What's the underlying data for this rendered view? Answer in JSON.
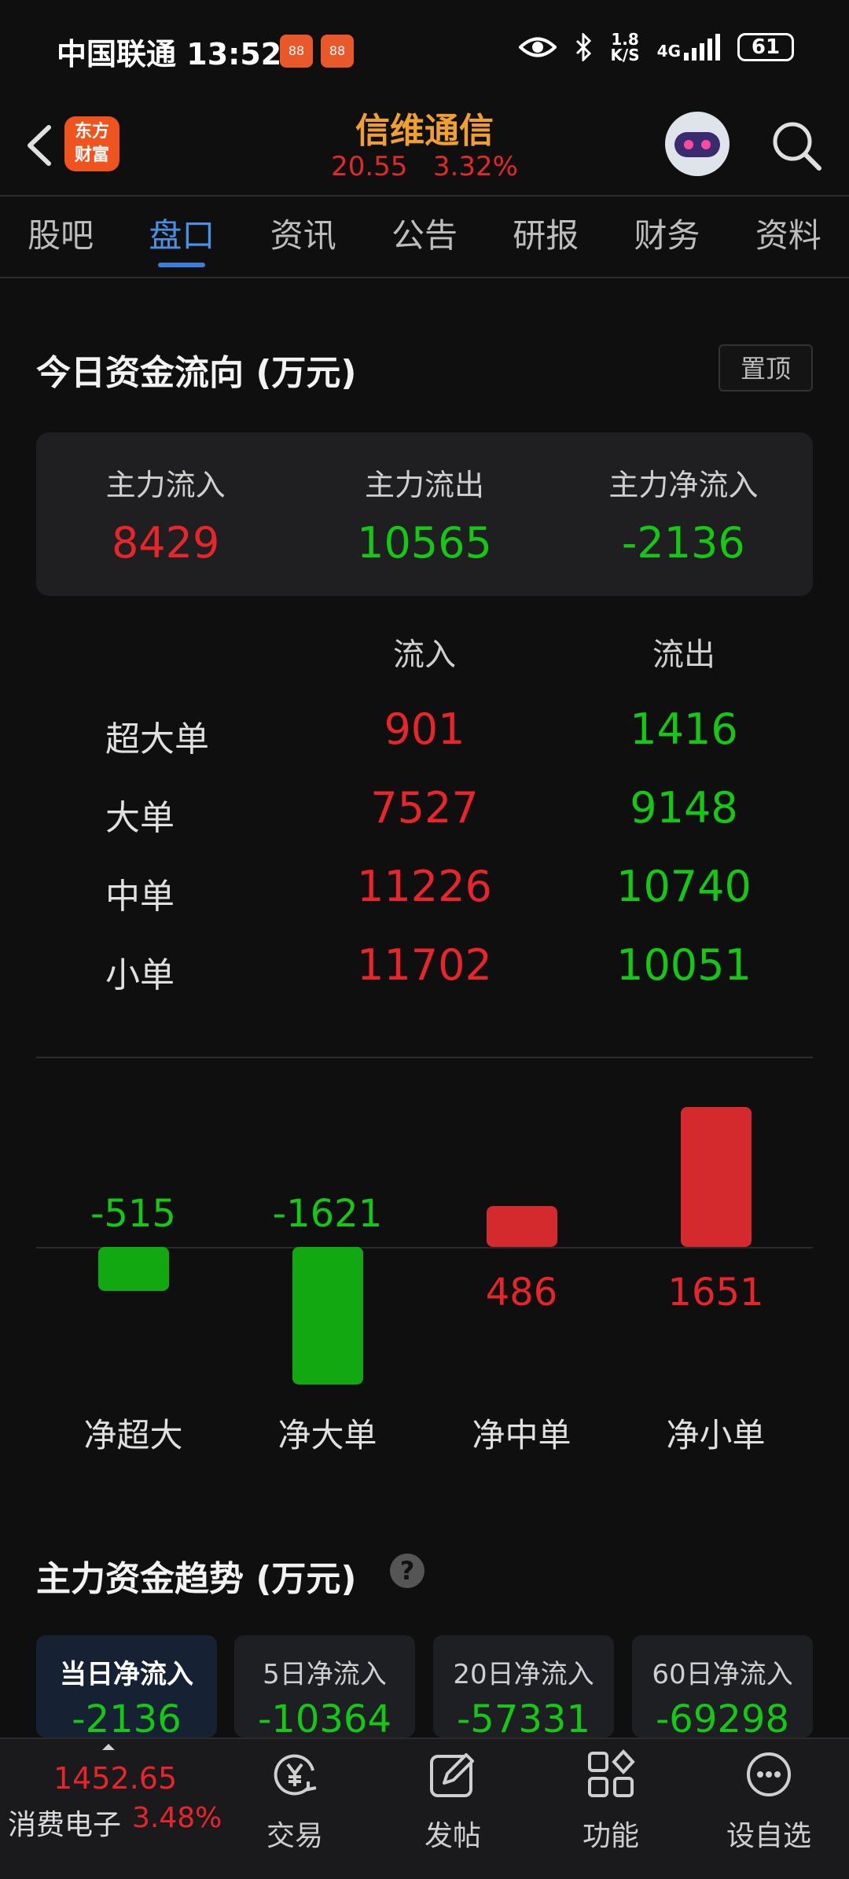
{
  "status_bar": {
    "carrier": "中国联通",
    "time": "13:52",
    "speed": "1.8",
    "speed_unit": "K/S",
    "network": "4G",
    "battery": "61"
  },
  "header": {
    "brand_line1": "东方",
    "brand_line2": "财富",
    "stock_name": "信维通信",
    "price": "20.55",
    "change_pct": "3.32%"
  },
  "tabs": [
    {
      "label": "股吧",
      "active": false
    },
    {
      "label": "盘口",
      "active": true
    },
    {
      "label": "资讯",
      "active": false
    },
    {
      "label": "公告",
      "active": false
    },
    {
      "label": "研报",
      "active": false
    },
    {
      "label": "财务",
      "active": false
    },
    {
      "label": "资料",
      "active": false
    }
  ],
  "capital_flow": {
    "title": "今日资金流向 (万元)",
    "pin_label": "置顶",
    "summary": [
      {
        "label": "主力流入",
        "value": "8429",
        "color": "red"
      },
      {
        "label": "主力流出",
        "value": "10565",
        "color": "green"
      },
      {
        "label": "主力净流入",
        "value": "-2136",
        "color": "green"
      }
    ],
    "table": {
      "headers": [
        "流入",
        "流出"
      ],
      "rows": [
        {
          "label": "超大单",
          "inflow": "901",
          "outflow": "1416"
        },
        {
          "label": "大单",
          "inflow": "7527",
          "outflow": "9148"
        },
        {
          "label": "中单",
          "inflow": "11226",
          "outflow": "10740"
        },
        {
          "label": "小单",
          "inflow": "11702",
          "outflow": "10051"
        }
      ]
    }
  },
  "chart_data": {
    "type": "bar",
    "categories": [
      "净超大",
      "净大单",
      "净中单",
      "净小单"
    ],
    "values": [
      -515,
      -1621,
      486,
      1651
    ],
    "title": "",
    "xlabel": "",
    "ylabel": "",
    "positive_color": "#d42a2e",
    "negative_color": "#12a812"
  },
  "trend": {
    "title": "主力资金趋势 (万元)",
    "help_icon": "?",
    "cards": [
      {
        "label": "当日净流入",
        "value": "-2136",
        "active": true
      },
      {
        "label": "5日净流入",
        "value": "-10364",
        "active": false
      },
      {
        "label": "20日净流入",
        "value": "-57331",
        "active": false
      },
      {
        "label": "60日净流入",
        "value": "-69298",
        "active": false
      }
    ]
  },
  "bottom_bar": {
    "index_value": "1452.65",
    "index_name": "消费电子",
    "index_pct": "3.48%",
    "nav": [
      {
        "label": "交易",
        "icon": "yen-cycle-icon"
      },
      {
        "label": "发帖",
        "icon": "edit-icon"
      },
      {
        "label": "功能",
        "icon": "grid-icon"
      },
      {
        "label": "设自选",
        "icon": "more-icon"
      }
    ]
  }
}
